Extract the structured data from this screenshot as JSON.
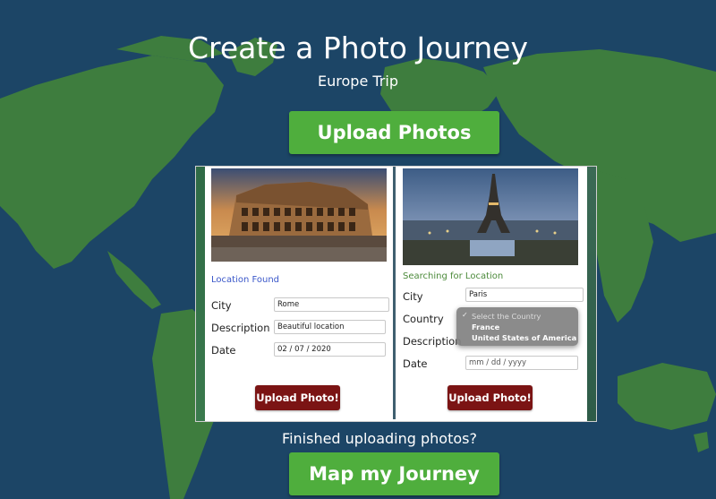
{
  "header": {
    "title": "Create a Photo Journey",
    "subtitle": "Europe Trip"
  },
  "upload_photos_label": "Upload Photos",
  "cards": [
    {
      "status": "Location Found",
      "city_label": "City",
      "city_value": "Rome",
      "description_label": "Description",
      "description_value": "Beautiful location",
      "date_label": "Date",
      "date_value": "02 / 07 / 2020",
      "button_label": "Upload Photo!"
    },
    {
      "status": "Searching for Location",
      "city_label": "City",
      "city_value": "Paris",
      "country_label": "Country",
      "description_label": "Description",
      "date_label": "Date",
      "date_placeholder": "mm / dd / yyyy",
      "button_label": "Upload Photo!"
    }
  ],
  "country_dropdown": {
    "check": "✓",
    "placeholder": "Select the Country",
    "options": [
      "France",
      "United States of America"
    ]
  },
  "footer": {
    "finished_text": "Finished uploading photos?",
    "map_button_label": "Map my Journey"
  },
  "colors": {
    "ocean": "#1c4566",
    "land": "#3e7d3e",
    "green_button": "#4fae3d",
    "red_button": "#7b1414"
  }
}
